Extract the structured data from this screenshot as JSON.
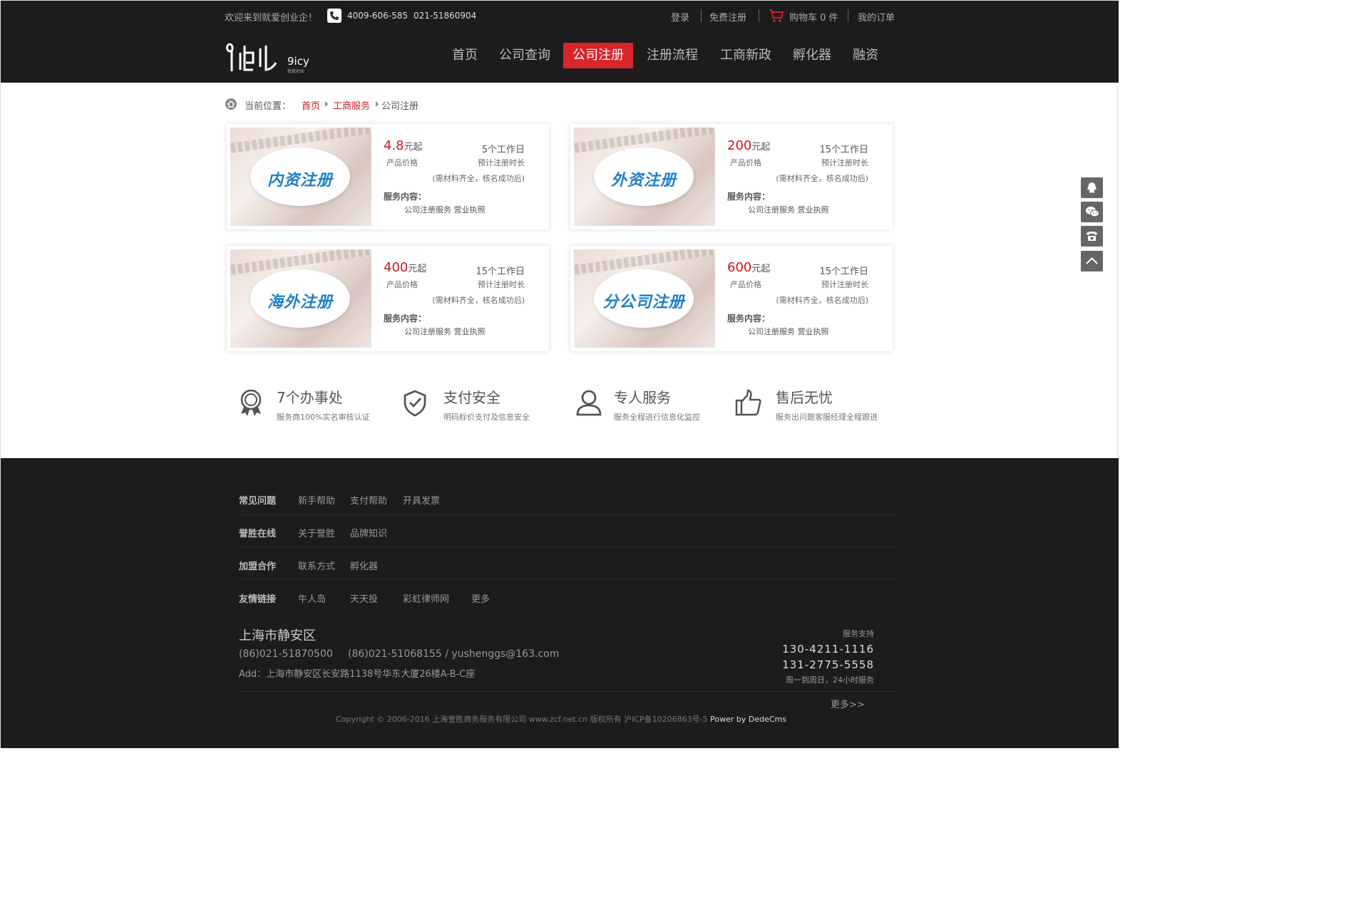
{
  "topbar": {
    "welcome": "欢迎来到就爱创业企！",
    "tel1": "4009-606-585",
    "tel2": "021-51860904",
    "login": "登录",
    "register": "免费注册",
    "cart": "购物车 0 件",
    "orders": "我的订单"
  },
  "logo": {
    "brand": "9icy",
    "sub": "就爱创业"
  },
  "nav": [
    "首页",
    "公司查询",
    "公司注册",
    "注册流程",
    "工商新政",
    "孵化器",
    "融资"
  ],
  "breadcrumb": {
    "label": "当前位置：",
    "home": "首页",
    "section": "工商服务",
    "current": "公司注册"
  },
  "products": [
    {
      "title": "内资注册",
      "price": "4.8",
      "price_unit": "元起",
      "price_label": "产品价格",
      "days": "5个工作日",
      "days_label": "预计注册时长",
      "note": "(需材料齐全，核名成功后)",
      "service_label": "服务内容：",
      "service": "公司注册服务 营业执照"
    },
    {
      "title": "外资注册",
      "price": "200",
      "price_unit": "元起",
      "price_label": "产品价格",
      "days": "15个工作日",
      "days_label": "预计注册时长",
      "note": "(需材料齐全，核名成功后)",
      "service_label": "服务内容：",
      "service": "公司注册服务 营业执照"
    },
    {
      "title": "海外注册",
      "price": "400",
      "price_unit": "元起",
      "price_label": "产品价格",
      "days": "15个工作日",
      "days_label": "预计注册时长",
      "note": "(需材料齐全，核名成功后)",
      "service_label": "服务内容：",
      "service": "公司注册服务 营业执照"
    },
    {
      "title": "分公司注册",
      "price": "600",
      "price_unit": "元起",
      "price_label": "产品价格",
      "days": "15个工作日",
      "days_label": "预计注册时长",
      "note": "(需材料齐全，核名成功后)",
      "service_label": "服务内容：",
      "service": "公司注册服务 营业执照"
    }
  ],
  "features": [
    {
      "title": "7个办事处",
      "sub": "服务商100%实名审核认证",
      "icon": "award-icon"
    },
    {
      "title": "支付安全",
      "sub": "明码标价支付及信息安全",
      "icon": "shield-check-icon"
    },
    {
      "title": "专人服务",
      "sub": "服务全程进行信息化监控",
      "icon": "user-icon"
    },
    {
      "title": "售后无忧",
      "sub": "服务出问题客服经理全程跟进",
      "icon": "thumbs-up-icon"
    }
  ],
  "sidebar_icons": [
    "qq-icon",
    "wechat-icon",
    "telephone-icon",
    "back-to-top-icon"
  ],
  "footer": {
    "rows": [
      {
        "label": "常见问题",
        "items": [
          "新手帮助",
          "支付帮助",
          "开具发票"
        ]
      },
      {
        "label": "誉胜在线",
        "items": [
          "关于誉胜",
          "品牌知识"
        ]
      },
      {
        "label": "加盟合作",
        "items": [
          "联系方式",
          "孵化器"
        ]
      },
      {
        "label": "友情链接",
        "items": [
          "牛人岛",
          "天天投",
          "彩虹律师网",
          "更多"
        ]
      }
    ],
    "city": "上海市静安区",
    "phone1": "(86)021-51870500",
    "phone2": "(86)021-51068155 / yushenggs@163.com",
    "address": "Add：上海市静安区长安路1138号华东大厦26楼A-B-C座",
    "support_label": "服务支持",
    "support_phone1": "130-4211-1116",
    "support_phone2": "131-2775-5558",
    "support_hours": "周一到周日，24小时服务",
    "more": "更多>>",
    "copyright": "Copyright © 2006-2016 上海誉胜商务服务有限公司 www.zcf.net.cn  版权所有  沪ICP备10206863号-5",
    "powered": "Power by DedeCms"
  },
  "colors": {
    "header_bg": "#1c1c1c",
    "accent_red": "#d8262d",
    "price_red": "#c8181e",
    "title_blue": "#1d7fc8"
  }
}
